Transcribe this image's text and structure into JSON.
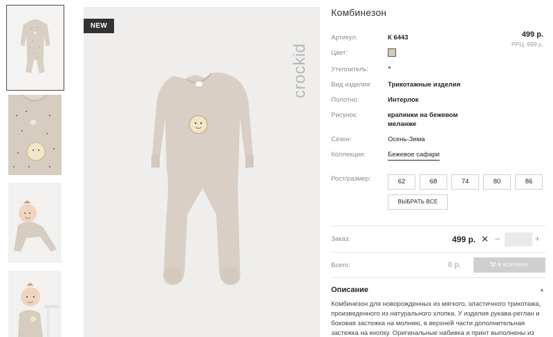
{
  "product": {
    "title": "Комбинезон",
    "badge": "NEW",
    "brand": "crockid"
  },
  "attributes": {
    "article_label": "Артикул:",
    "article_value": "К 6443",
    "color_label": "Цвет:",
    "color_swatch": "#d7cdb5",
    "insulation_label": "Утеплитель:",
    "insulation_value": "\"",
    "type_label": "Вид изделия:",
    "type_value": "Трикотажные изделия",
    "fabric_label": "Полотно:",
    "fabric_value": "Интерлок",
    "pattern_label": "Рисунок:",
    "pattern_value_line1": "крапинки на бежевом",
    "pattern_value_line2": "меланже",
    "season_label": "Сезон:",
    "season_value": "Осень-Зима",
    "collection_label": "Коллекция:",
    "collection_value": "Бежевое сафари"
  },
  "price": {
    "value": "499 р.",
    "rrp": "РРЦ: 999 р."
  },
  "sizes": {
    "label": "Рост/размер:",
    "options": [
      "62",
      "68",
      "74",
      "80",
      "86"
    ],
    "select_all": "ВЫБРАТЬ ВСЕ"
  },
  "order": {
    "label": "Заказ:",
    "price": "499 р.",
    "times": "✕",
    "minus": "–",
    "plus": "+",
    "quantity": ""
  },
  "total": {
    "label": "Всего:",
    "value": "0 р.",
    "cart_button": "В КОРЗИНУ"
  },
  "description": {
    "heading": "Описание",
    "caret": "▲",
    "text": "Комбинезон для новорожденных из мягкого, эластичного трикотажа, произведенного из натурального хлопка. У изделия рукава-реглан и боковая застежка на молнию, в верхней части дополнительная застежка на кнопку. Оригинальные набивка и принт выполнены из"
  },
  "colors": {
    "fabric": "#d9cfc4",
    "dots": "#3a3a3a",
    "badge_bg": "#333333",
    "button_disabled": "#cfcfcf"
  }
}
